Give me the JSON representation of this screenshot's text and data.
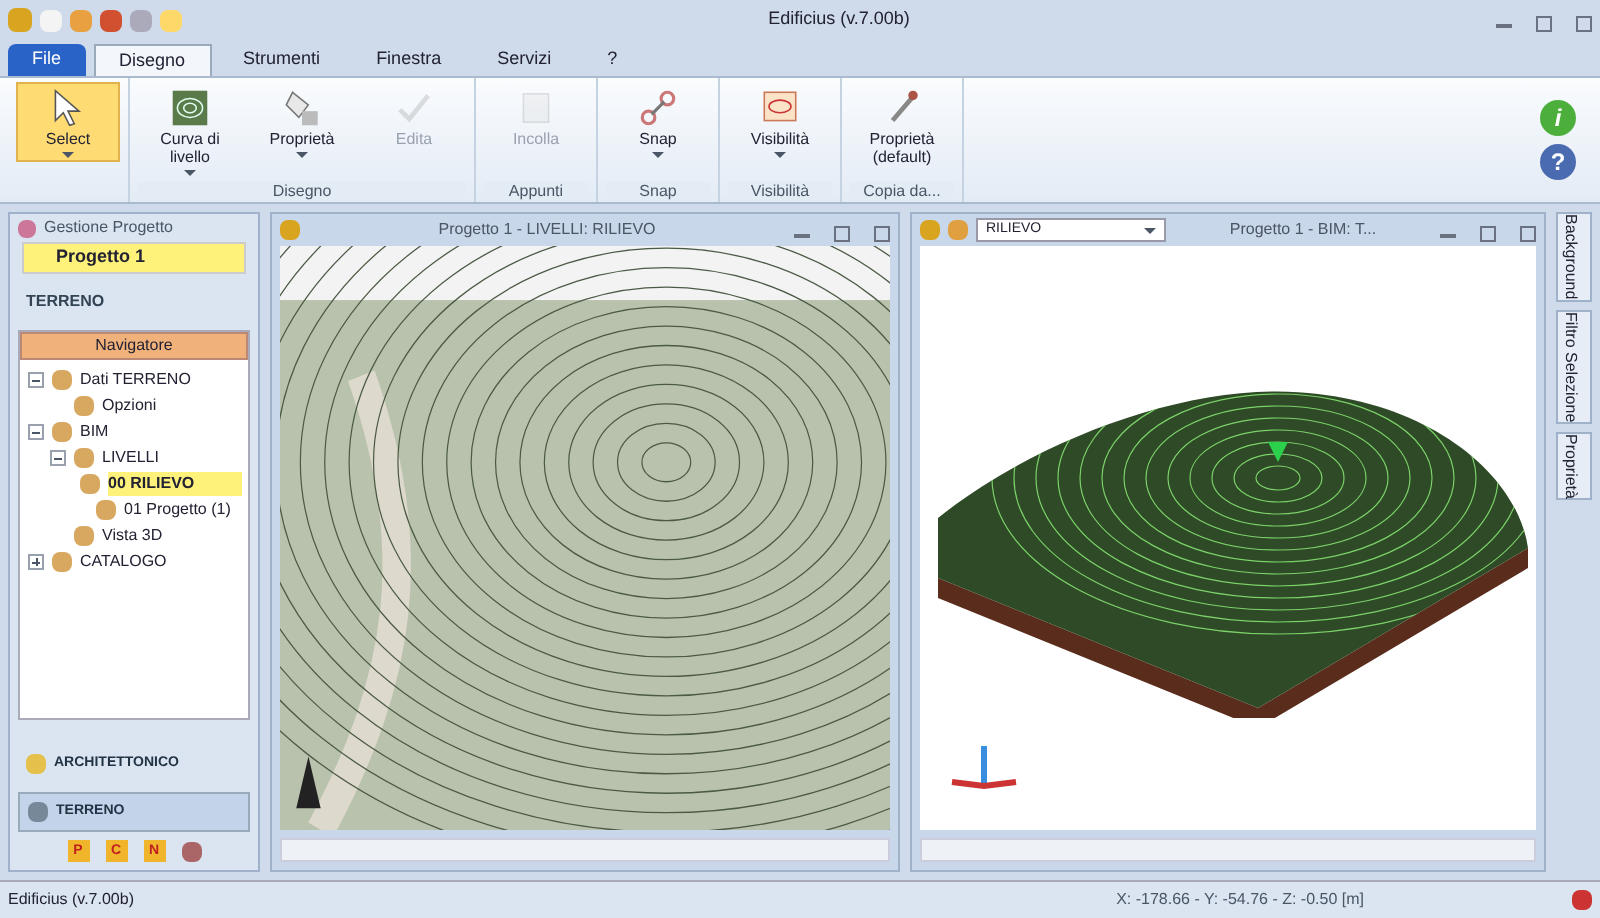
{
  "window": {
    "title": "Edificius (v.7.00b)"
  },
  "menu_tabs": [
    {
      "label": "File",
      "kind": "file",
      "selected": false
    },
    {
      "label": "Disegno",
      "kind": "tab",
      "selected": true
    },
    {
      "label": "Strumenti",
      "kind": "tab",
      "selected": false
    },
    {
      "label": "Finestra",
      "kind": "tab",
      "selected": false
    },
    {
      "label": "Servizi",
      "kind": "tab",
      "selected": false
    },
    {
      "label": "?",
      "kind": "tab",
      "selected": false
    }
  ],
  "ribbon_groups": [
    {
      "buttons": [
        {
          "label": "Select",
          "selected": true,
          "disabled": false,
          "dropdown": true
        }
      ]
    },
    {
      "label": "Disegno",
      "buttons": [
        {
          "label": "Curva di livello",
          "selected": false,
          "disabled": false,
          "dropdown": true
        },
        {
          "label": "Proprietà",
          "selected": false,
          "disabled": false,
          "dropdown": true
        },
        {
          "label": "Edita",
          "selected": false,
          "disabled": true,
          "dropdown": false
        }
      ]
    },
    {
      "label": "Appunti",
      "buttons": [
        {
          "label": "Incolla",
          "selected": false,
          "disabled": true,
          "dropdown": false
        }
      ]
    },
    {
      "label": "Snap",
      "buttons": [
        {
          "label": "Snap",
          "selected": false,
          "disabled": false,
          "dropdown": true
        }
      ]
    },
    {
      "label": "Visibilità",
      "buttons": [
        {
          "label": "Visibilità",
          "selected": false,
          "disabled": false,
          "dropdown": true
        }
      ]
    },
    {
      "label": "Copia da...",
      "buttons": [
        {
          "label": "Proprietà (default)",
          "selected": false,
          "disabled": false,
          "dropdown": false
        }
      ]
    }
  ],
  "help_buttons": [
    "i",
    "?"
  ],
  "project_panel": {
    "title": "Gestione Progetto",
    "project": "Progetto 1",
    "section": "TERRENO",
    "navigator": "Navigatore",
    "tree": [
      {
        "label": "Dati TERRENO",
        "selected": false,
        "expanded": true,
        "children": [
          {
            "label": "Opzioni",
            "selected": false
          }
        ]
      },
      {
        "label": "BIM",
        "selected": false,
        "expanded": true,
        "children": [
          {
            "label": "LIVELLI",
            "selected": false,
            "expanded": true,
            "children": [
              {
                "label": "00 RILIEVO",
                "selected": true
              },
              {
                "label": "01 Progetto (1)",
                "selected": false
              }
            ]
          },
          {
            "label": "Vista 3D",
            "selected": false
          }
        ]
      },
      {
        "label": "CATALOGO",
        "selected": false,
        "expanded": false
      }
    ],
    "modules": [
      {
        "label": "ARCHITETTONICO",
        "selected": false
      },
      {
        "label": "TERRENO",
        "selected": true
      }
    ],
    "mini_buttons": [
      "P",
      "C",
      "N"
    ]
  },
  "plan_view": {
    "title": "Progetto 1 -  LIVELLI: RILIEVO"
  },
  "view_3d": {
    "level_select": "RILIEVO",
    "title": "Progetto 1 - BIM: T..."
  },
  "side_tabs": [
    "Background",
    "Filtro Selezione",
    "Proprietà"
  ],
  "status_bar": {
    "app": "Edificius (v.7.00b)",
    "coordinates": "X: -178.66 - Y: -54.76 - Z: -0.50 [m]"
  }
}
